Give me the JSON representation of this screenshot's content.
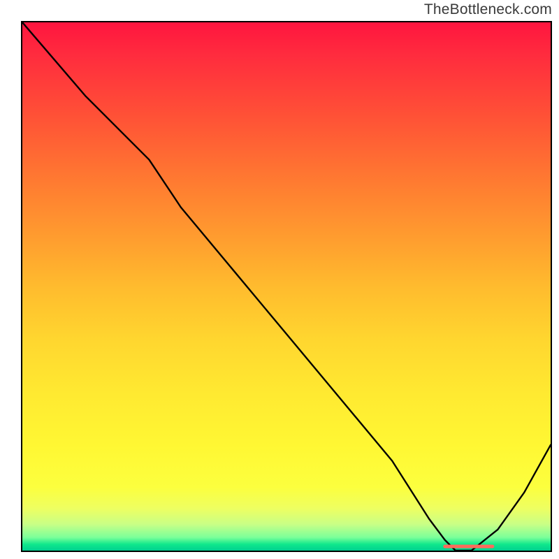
{
  "watermark": "TheBottleneck.com",
  "chart_data": {
    "type": "line",
    "title": "",
    "xlabel": "",
    "ylabel": "",
    "xlim": [
      0,
      100
    ],
    "ylim": [
      0,
      100
    ],
    "grid": false,
    "gradient": {
      "direction": "vertical",
      "stops": [
        {
          "pos": 0,
          "color": "#ff153f"
        },
        {
          "pos": 50,
          "color": "#ffd22e"
        },
        {
          "pos": 90,
          "color": "#f6ff45"
        },
        {
          "pos": 100,
          "color": "#00cf8f"
        }
      ]
    },
    "series": [
      {
        "name": "bottleneck-curve",
        "color": "#000000",
        "x": [
          0,
          6,
          12,
          18,
          24,
          30,
          40,
          50,
          60,
          70,
          77,
          80,
          82,
          85,
          90,
          95,
          100
        ],
        "y": [
          100,
          93,
          86,
          80,
          74,
          65,
          53,
          41,
          29,
          17,
          6,
          2,
          0,
          0,
          4,
          11,
          20
        ]
      }
    ],
    "markers": [
      {
        "name": "highlight-segment",
        "type": "line-segment",
        "color": "#ff6a5b",
        "thickness": 5,
        "x0": 80,
        "y0": 0.8,
        "x1": 89,
        "y1": 0.8
      }
    ]
  }
}
